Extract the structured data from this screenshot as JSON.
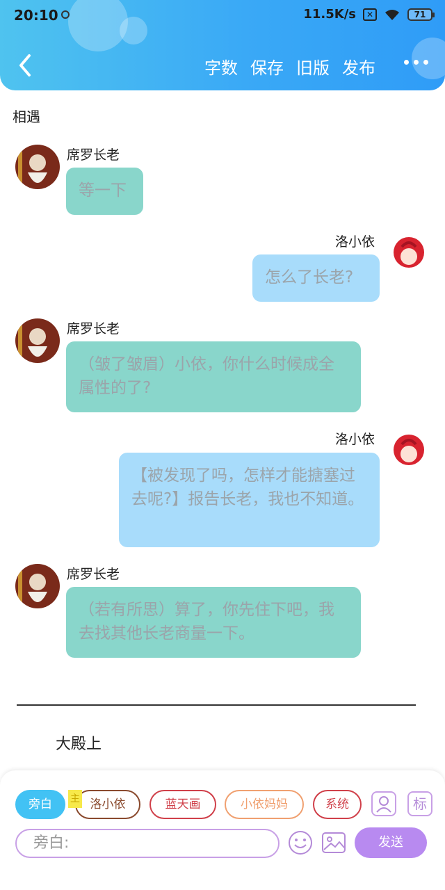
{
  "status_bar": {
    "time": "20:10",
    "net_speed": "11.5K/s",
    "battery": "71"
  },
  "nav": {
    "actions": [
      "字数",
      "保存",
      "旧版",
      "发布"
    ]
  },
  "section_title": "相遇",
  "messages": [
    {
      "side": "left",
      "name": "席罗长老",
      "text": "等一下"
    },
    {
      "side": "right",
      "name": "洛小依",
      "text": "怎么了长老?"
    },
    {
      "side": "left",
      "name": "席罗长老",
      "text": "（皱了皱眉）小依，你什么时候成全属性的了?"
    },
    {
      "side": "right",
      "name": "洛小依",
      "text": "【被发现了吗，怎样才能搪塞过去呢?】报告长老，我也不知道。"
    },
    {
      "side": "left",
      "name": "席罗长老",
      "text": "（若有所思）算了，你先住下吧，我去找其他长老商量一下。"
    }
  ],
  "next_section_title": "大殿上",
  "composer": {
    "chips": [
      {
        "label": "旁白",
        "active": true,
        "color": "#42c2f4"
      },
      {
        "label": "洛小依",
        "active": false,
        "color": "#8a4a2e"
      },
      {
        "label": "蓝天画",
        "active": false,
        "color": "#d0404a"
      },
      {
        "label": "小依妈妈",
        "active": false,
        "color": "#f0a070"
      },
      {
        "label": "系统",
        "active": false,
        "color": "#d0404a"
      }
    ],
    "main_badge": "主",
    "mark_label": "标",
    "input_placeholder": "旁白:",
    "send_label": "发送"
  }
}
